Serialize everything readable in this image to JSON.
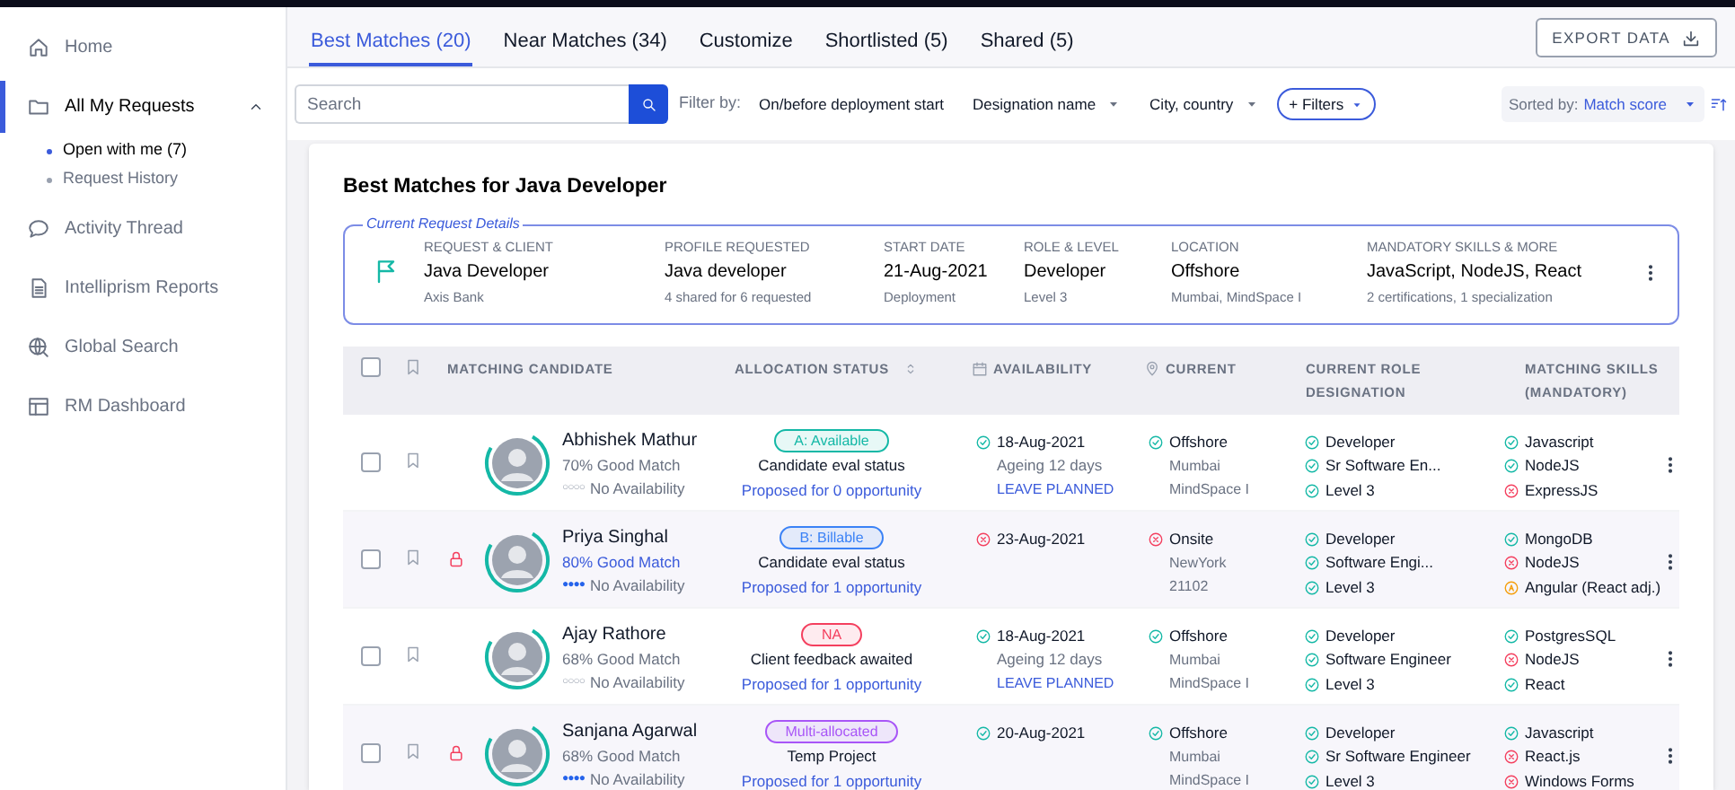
{
  "sidebar": {
    "items": [
      {
        "label": "Home",
        "selected": false
      },
      {
        "label": "All My Requests",
        "selected": true,
        "expanded": true,
        "children": [
          {
            "label": "Open with me (7)",
            "selected": true
          },
          {
            "label": "Request History",
            "selected": false
          }
        ]
      },
      {
        "label": "Activity Thread",
        "selected": false
      },
      {
        "label": "Intelliprism Reports",
        "selected": false
      },
      {
        "label": "Global Search",
        "selected": false
      },
      {
        "label": "RM Dashboard",
        "selected": false
      }
    ]
  },
  "tabs": [
    {
      "label": "Best Matches (20)",
      "selected": true
    },
    {
      "label": "Near Matches (34)",
      "selected": false
    },
    {
      "label": "Customize",
      "selected": false
    },
    {
      "label": "Shortlisted (5)",
      "selected": false
    },
    {
      "label": "Shared (5)",
      "selected": false
    }
  ],
  "export_button": "EXPORT DATA",
  "filter_bar": {
    "search": {
      "placeholder": "Search"
    },
    "filter_label": "Filter by:",
    "filters": [
      {
        "kind": "plain",
        "label": "On/before deployment start"
      },
      {
        "kind": "dropdown",
        "label": "Designation name"
      },
      {
        "kind": "dropdown",
        "label": "City, country"
      },
      {
        "kind": "pill",
        "label": "+ Filters"
      }
    ],
    "sort": {
      "label": "Sorted by:",
      "value": "Match score"
    }
  },
  "title": "Best Matches for Java Developer",
  "request_details": {
    "legend": "Current Request Details",
    "fields": [
      {
        "heading": "REQUEST & CLIENT",
        "value": "Java Developer",
        "sub": "Axis Bank"
      },
      {
        "heading": "PROFILE REQUESTED",
        "value": "Java developer",
        "sub": "4 shared for 6 requested"
      },
      {
        "heading": "START DATE",
        "value": "21-Aug-2021",
        "sub": "Deployment"
      },
      {
        "heading": "ROLE & LEVEL",
        "value": "Developer",
        "sub": "Level 3"
      },
      {
        "heading": "LOCATION",
        "value": "Offshore",
        "sub": "Mumbai, MindSpace I"
      },
      {
        "heading": "MANDATORY SKILLS & MORE",
        "value": "JavaScript, NodeJS, React",
        "sub": "2 certifications, 1 specialization"
      }
    ]
  },
  "table": {
    "header_checked": false,
    "columns": [
      "MATCHING CANDIDATE",
      "ALLOCATION STATUS",
      "AVAILABILITY",
      "CURRENT",
      "CURRENT ROLE DESIGNATION",
      "MATCHING SKILLS (MANDATORY)"
    ],
    "rows": [
      {
        "checked": false,
        "locked": false,
        "name": "Abhishek Mathur",
        "match": "70% Good Match",
        "match_highlight": false,
        "dots_filled": false,
        "dots_text": "○○○○",
        "availability": "No Availability",
        "badge": "A: Available",
        "color": "#14b8a6",
        "status": "Candidate eval status",
        "proposal": "Proposed for 0 opportunity",
        "avail": {
          "kind": "match",
          "date": "18-Aug-2021",
          "sub": "Ageing 12 days",
          "note": "LEAVE PLANNED"
        },
        "current": {
          "kind": "match",
          "place": "Offshore",
          "lines": [
            "Mumbai",
            "MindSpace I"
          ]
        },
        "role": [
          {
            "kind": "match",
            "text": "Developer"
          },
          {
            "kind": "match",
            "text": "Sr Software En..."
          },
          {
            "kind": "match",
            "text": "Level 3"
          }
        ],
        "skills": [
          {
            "kind": "match",
            "text": "Javascript"
          },
          {
            "kind": "match",
            "text": "NodeJS"
          },
          {
            "kind": "missing",
            "text": "ExpressJS"
          }
        ]
      },
      {
        "checked": false,
        "locked": true,
        "name": "Priya Singhal",
        "match": "80% Good Match",
        "match_highlight": true,
        "dots_filled": true,
        "dots_text": "●●●●",
        "availability": "No Availability",
        "badge": "B: Billable",
        "color": "#3b82f6",
        "status": "Candidate eval status",
        "proposal": "Proposed for 1 opportunity",
        "avail": {
          "kind": "missing",
          "date": "23-Aug-2021"
        },
        "current": {
          "kind": "missing",
          "place": "Onsite",
          "lines": [
            "NewYork",
            "21102"
          ]
        },
        "role": [
          {
            "kind": "match",
            "text": "Developer"
          },
          {
            "kind": "match",
            "text": "Software Engi..."
          },
          {
            "kind": "match",
            "text": "Level 3"
          }
        ],
        "skills": [
          {
            "kind": "match",
            "text": "MongoDB"
          },
          {
            "kind": "missing",
            "text": "NodeJS"
          },
          {
            "kind": "partial",
            "text": "Angular (React adj.)"
          }
        ]
      },
      {
        "checked": false,
        "locked": false,
        "name": "Ajay Rathore",
        "match": "68% Good Match",
        "match_highlight": false,
        "dots_filled": false,
        "dots_text": "○○○○",
        "availability": "No Availability",
        "badge": "NA",
        "color": "#f43f5e",
        "status": "Client feedback awaited",
        "proposal": "Proposed for 1 opportunity",
        "avail": {
          "kind": "match",
          "date": "18-Aug-2021",
          "sub": "Ageing 12 days",
          "note": "LEAVE PLANNED"
        },
        "current": {
          "kind": "match",
          "place": "Offshore",
          "lines": [
            "Mumbai",
            "MindSpace I"
          ]
        },
        "role": [
          {
            "kind": "match",
            "text": "Developer"
          },
          {
            "kind": "match",
            "text": "Software Engineer"
          },
          {
            "kind": "match",
            "text": "Level 3"
          }
        ],
        "skills": [
          {
            "kind": "match",
            "text": "PostgresSQL"
          },
          {
            "kind": "missing",
            "text": "NodeJS"
          },
          {
            "kind": "match",
            "text": "React"
          }
        ]
      },
      {
        "checked": false,
        "locked": true,
        "name": "Sanjana Agarwal",
        "match": "68% Good Match",
        "match_highlight": false,
        "dots_filled": true,
        "dots_text": "●●●●",
        "availability": "No Availability",
        "badge": "Multi-allocated",
        "color": "#a855f7",
        "status": "Temp Project",
        "proposal": "Proposed for 1 opportunity",
        "avail": {
          "kind": "match",
          "date": "20-Aug-2021"
        },
        "current": {
          "kind": "match",
          "place": "Offshore",
          "lines": [
            "Mumbai",
            "MindSpace I"
          ]
        },
        "role": [
          {
            "kind": "match",
            "text": "Developer"
          },
          {
            "kind": "match",
            "text": "Sr Software Engineer"
          },
          {
            "kind": "match",
            "text": "Level 3"
          }
        ],
        "skills": [
          {
            "kind": "match",
            "text": "Javascript"
          },
          {
            "kind": "missing",
            "text": "React.js"
          },
          {
            "kind": "missing",
            "text": "Windows Forms"
          }
        ]
      }
    ]
  }
}
